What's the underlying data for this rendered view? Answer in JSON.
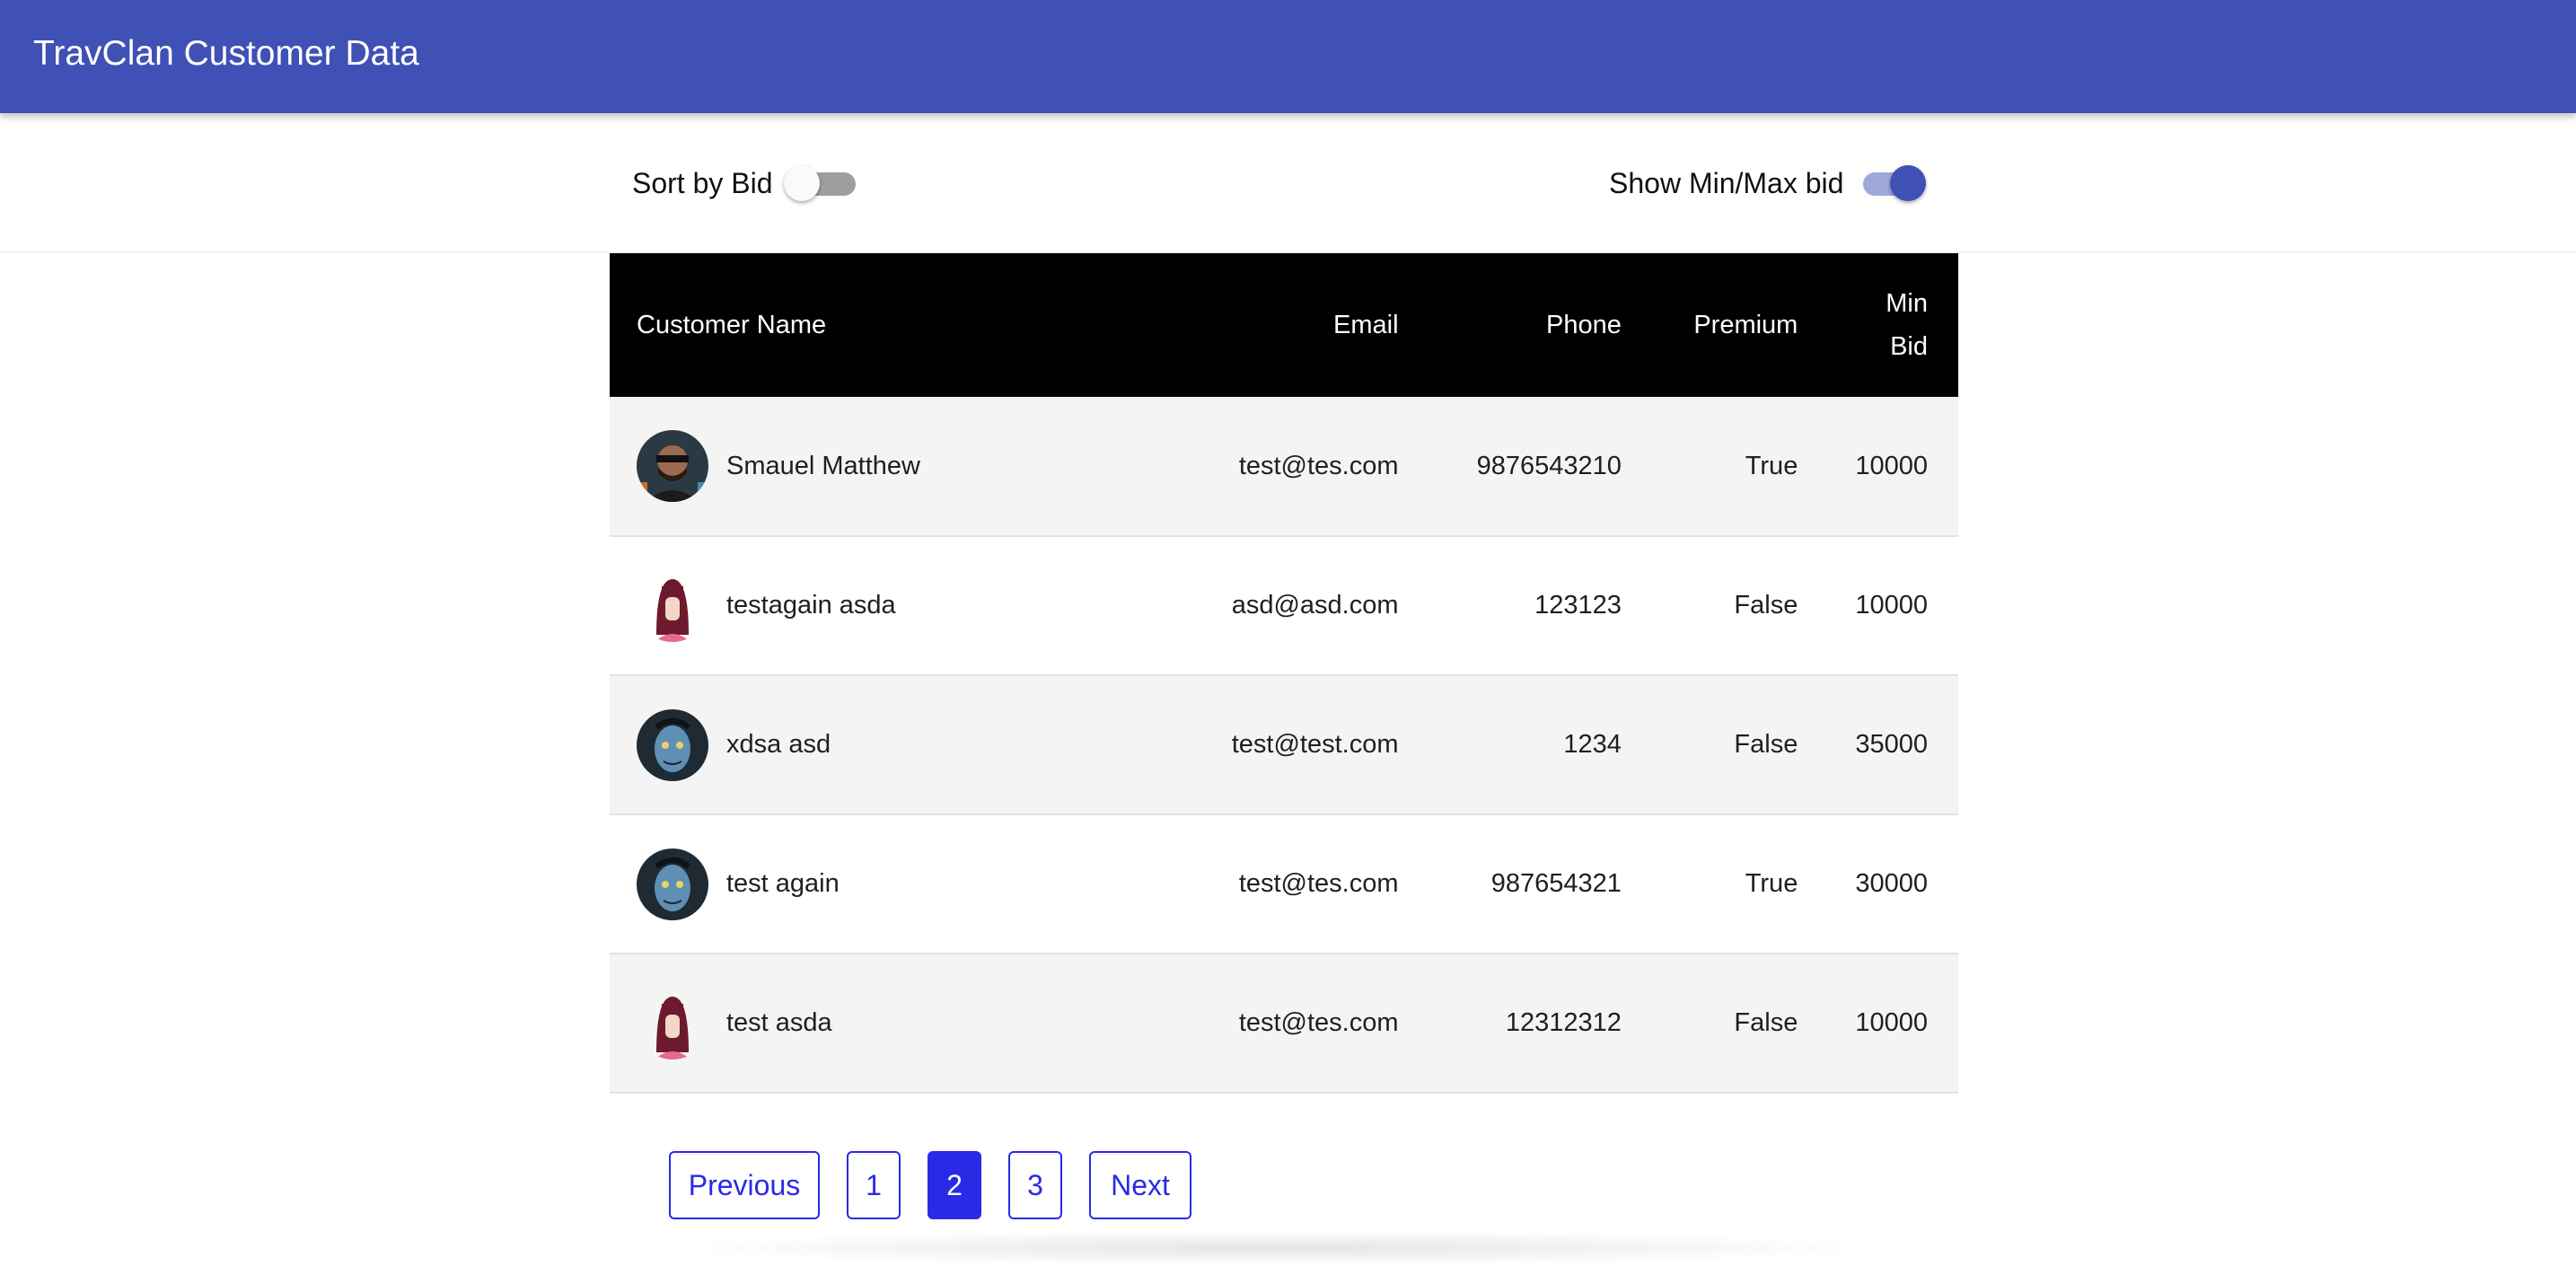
{
  "app": {
    "title": "TravClan Customer Data"
  },
  "controls": {
    "sort_label": "Sort by Bid",
    "sort_on": false,
    "minmax_label": "Show Min/Max bid",
    "minmax_on": true
  },
  "table": {
    "headers": {
      "name": "Customer Name",
      "email": "Email",
      "phone": "Phone",
      "premium": "Premium",
      "bid_line1": "Min",
      "bid_line2": "Bid"
    },
    "rows": [
      {
        "name": "Smauel Matthew",
        "email": "test@tes.com",
        "phone": "9876543210",
        "premium": "True",
        "bid": "10000",
        "avatar": "man-photo-avatar"
      },
      {
        "name": "testagain asda",
        "email": "asd@asd.com",
        "phone": "123123",
        "premium": "False",
        "bid": "10000",
        "avatar": "woman-avatar"
      },
      {
        "name": "xdsa asd",
        "email": "test@test.com",
        "phone": "1234",
        "premium": "False",
        "bid": "35000",
        "avatar": "blue-face-avatar"
      },
      {
        "name": "test again",
        "email": "test@tes.com",
        "phone": "987654321",
        "premium": "True",
        "bid": "30000",
        "avatar": "blue-face-avatar"
      },
      {
        "name": "test asda",
        "email": "test@tes.com",
        "phone": "12312312",
        "premium": "False",
        "bid": "10000",
        "avatar": "woman-avatar"
      }
    ]
  },
  "pagination": {
    "previous": "Previous",
    "pages": [
      "1",
      "2",
      "3"
    ],
    "current": "2",
    "next": "Next"
  },
  "colors": {
    "appbar": "#3f51b5",
    "header_bg": "#000000",
    "pager_accent": "#2a2ae6"
  }
}
